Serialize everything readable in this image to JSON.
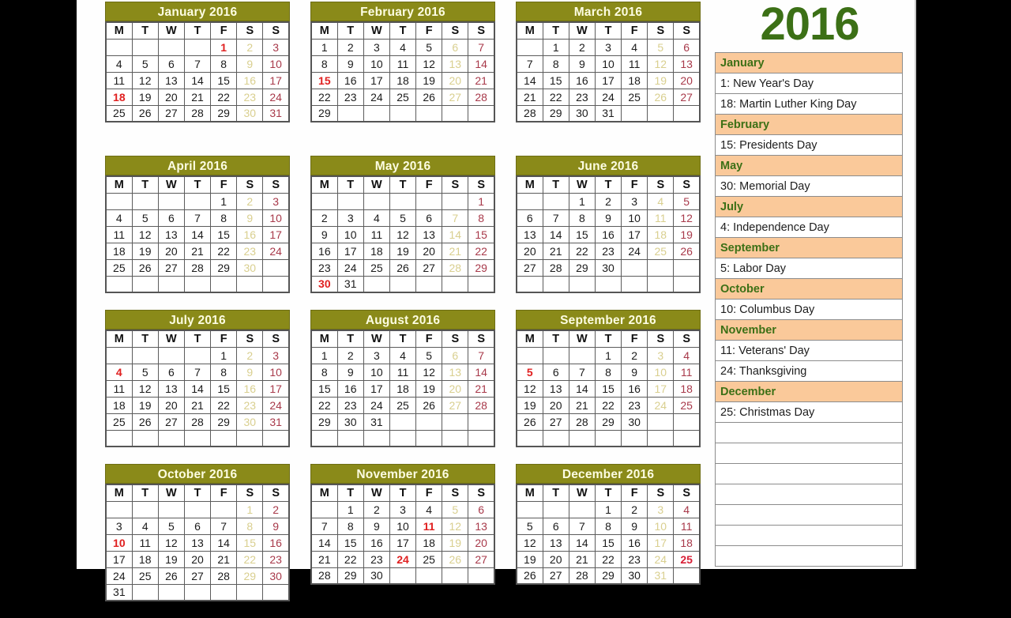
{
  "year_title": "2016",
  "weekday_headers": [
    "M",
    "T",
    "W",
    "T",
    "F",
    "S",
    "S"
  ],
  "colors": {
    "month_header_bg": "#8a8a19",
    "month_header_text": "#fdfde2",
    "saturday": "#d9cf8f",
    "sunday": "#a8394a",
    "holiday": "#e02020",
    "year_green": "#3c7016",
    "sidebar_month_bg": "#fac99a",
    "sidebar_month_text": "#3c7016",
    "page_bg": "#fefefe",
    "letterbox": "#000000"
  },
  "months": [
    {
      "title": "January 2016",
      "weeks": [
        [
          "",
          "",
          "",
          "",
          "1",
          "2",
          "3"
        ],
        [
          "4",
          "5",
          "6",
          "7",
          "8",
          "9",
          "10"
        ],
        [
          "11",
          "12",
          "13",
          "14",
          "15",
          "16",
          "17"
        ],
        [
          "18",
          "19",
          "20",
          "21",
          "22",
          "23",
          "24"
        ],
        [
          "25",
          "26",
          "27",
          "28",
          "29",
          "30",
          "31"
        ]
      ],
      "holidays": [
        "1",
        "18"
      ]
    },
    {
      "title": "February 2016",
      "weeks": [
        [
          "1",
          "2",
          "3",
          "4",
          "5",
          "6",
          "7"
        ],
        [
          "8",
          "9",
          "10",
          "11",
          "12",
          "13",
          "14"
        ],
        [
          "15",
          "16",
          "17",
          "18",
          "19",
          "20",
          "21"
        ],
        [
          "22",
          "23",
          "24",
          "25",
          "26",
          "27",
          "28"
        ],
        [
          "29",
          "",
          "",
          "",
          "",
          "",
          ""
        ]
      ],
      "holidays": [
        "15"
      ]
    },
    {
      "title": "March 2016",
      "weeks": [
        [
          "",
          "1",
          "2",
          "3",
          "4",
          "5",
          "6"
        ],
        [
          "7",
          "8",
          "9",
          "10",
          "11",
          "12",
          "13"
        ],
        [
          "14",
          "15",
          "16",
          "17",
          "18",
          "19",
          "20"
        ],
        [
          "21",
          "22",
          "23",
          "24",
          "25",
          "26",
          "27"
        ],
        [
          "28",
          "29",
          "30",
          "31",
          "",
          "",
          ""
        ]
      ],
      "holidays": []
    },
    {
      "title": "April 2016",
      "weeks": [
        [
          "",
          "",
          "",
          "",
          "1",
          "2",
          "3"
        ],
        [
          "4",
          "5",
          "6",
          "7",
          "8",
          "9",
          "10"
        ],
        [
          "11",
          "12",
          "13",
          "14",
          "15",
          "16",
          "17"
        ],
        [
          "18",
          "19",
          "20",
          "21",
          "22",
          "23",
          "24"
        ],
        [
          "25",
          "26",
          "27",
          "28",
          "29",
          "30",
          ""
        ],
        [
          "",
          "",
          "",
          "",
          "",
          "",
          ""
        ]
      ],
      "holidays": []
    },
    {
      "title": "May 2016",
      "weeks": [
        [
          "",
          "",
          "",
          "",
          "",
          "",
          "1"
        ],
        [
          "2",
          "3",
          "4",
          "5",
          "6",
          "7",
          "8"
        ],
        [
          "9",
          "10",
          "11",
          "12",
          "13",
          "14",
          "15"
        ],
        [
          "16",
          "17",
          "18",
          "19",
          "20",
          "21",
          "22"
        ],
        [
          "23",
          "24",
          "25",
          "26",
          "27",
          "28",
          "29"
        ],
        [
          "30",
          "31",
          "",
          "",
          "",
          "",
          ""
        ]
      ],
      "holidays": [
        "30"
      ]
    },
    {
      "title": "June 2016",
      "weeks": [
        [
          "",
          "",
          "1",
          "2",
          "3",
          "4",
          "5"
        ],
        [
          "6",
          "7",
          "8",
          "9",
          "10",
          "11",
          "12"
        ],
        [
          "13",
          "14",
          "15",
          "16",
          "17",
          "18",
          "19"
        ],
        [
          "20",
          "21",
          "22",
          "23",
          "24",
          "25",
          "26"
        ],
        [
          "27",
          "28",
          "29",
          "30",
          "",
          "",
          ""
        ],
        [
          "",
          "",
          "",
          "",
          "",
          "",
          ""
        ]
      ],
      "holidays": []
    },
    {
      "title": "July 2016",
      "weeks": [
        [
          "",
          "",
          "",
          "",
          "1",
          "2",
          "3"
        ],
        [
          "4",
          "5",
          "6",
          "7",
          "8",
          "9",
          "10"
        ],
        [
          "11",
          "12",
          "13",
          "14",
          "15",
          "16",
          "17"
        ],
        [
          "18",
          "19",
          "20",
          "21",
          "22",
          "23",
          "24"
        ],
        [
          "25",
          "26",
          "27",
          "28",
          "29",
          "30",
          "31"
        ],
        [
          "",
          "",
          "",
          "",
          "",
          "",
          ""
        ]
      ],
      "holidays": [
        "4"
      ]
    },
    {
      "title": "August 2016",
      "weeks": [
        [
          "1",
          "2",
          "3",
          "4",
          "5",
          "6",
          "7"
        ],
        [
          "8",
          "9",
          "10",
          "11",
          "12",
          "13",
          "14"
        ],
        [
          "15",
          "16",
          "17",
          "18",
          "19",
          "20",
          "21"
        ],
        [
          "22",
          "23",
          "24",
          "25",
          "26",
          "27",
          "28"
        ],
        [
          "29",
          "30",
          "31",
          "",
          "",
          "",
          ""
        ],
        [
          "",
          "",
          "",
          "",
          "",
          "",
          ""
        ]
      ],
      "holidays": []
    },
    {
      "title": "September 2016",
      "weeks": [
        [
          "",
          "",
          "",
          "1",
          "2",
          "3",
          "4"
        ],
        [
          "5",
          "6",
          "7",
          "8",
          "9",
          "10",
          "11"
        ],
        [
          "12",
          "13",
          "14",
          "15",
          "16",
          "17",
          "18"
        ],
        [
          "19",
          "20",
          "21",
          "22",
          "23",
          "24",
          "25"
        ],
        [
          "26",
          "27",
          "28",
          "29",
          "30",
          "",
          ""
        ],
        [
          "",
          "",
          "",
          "",
          "",
          "",
          ""
        ]
      ],
      "holidays": [
        "5"
      ]
    },
    {
      "title": "October 2016",
      "weeks": [
        [
          "",
          "",
          "",
          "",
          "",
          "1",
          "2"
        ],
        [
          "3",
          "4",
          "5",
          "6",
          "7",
          "8",
          "9"
        ],
        [
          "10",
          "11",
          "12",
          "13",
          "14",
          "15",
          "16"
        ],
        [
          "17",
          "18",
          "19",
          "20",
          "21",
          "22",
          "23"
        ],
        [
          "24",
          "25",
          "26",
          "27",
          "28",
          "29",
          "30"
        ],
        [
          "31",
          "",
          "",
          "",
          "",
          "",
          ""
        ]
      ],
      "holidays": [
        "10"
      ]
    },
    {
      "title": "November 2016",
      "weeks": [
        [
          "",
          "1",
          "2",
          "3",
          "4",
          "5",
          "6"
        ],
        [
          "7",
          "8",
          "9",
          "10",
          "11",
          "12",
          "13"
        ],
        [
          "14",
          "15",
          "16",
          "17",
          "18",
          "19",
          "20"
        ],
        [
          "21",
          "22",
          "23",
          "24",
          "25",
          "26",
          "27"
        ],
        [
          "28",
          "29",
          "30",
          "",
          "",
          "",
          ""
        ]
      ],
      "holidays": [
        "11",
        "24"
      ]
    },
    {
      "title": "December 2016",
      "weeks": [
        [
          "",
          "",
          "",
          "1",
          "2",
          "3",
          "4"
        ],
        [
          "5",
          "6",
          "7",
          "8",
          "9",
          "10",
          "11"
        ],
        [
          "12",
          "13",
          "14",
          "15",
          "16",
          "17",
          "18"
        ],
        [
          "19",
          "20",
          "21",
          "22",
          "23",
          "24",
          "25"
        ],
        [
          "26",
          "27",
          "28",
          "29",
          "30",
          "31",
          ""
        ]
      ],
      "holidays": [
        "25"
      ]
    }
  ],
  "holiday_panel": {
    "rows": [
      {
        "type": "month",
        "text": "January"
      },
      {
        "type": "item",
        "text": "1: New Year's Day"
      },
      {
        "type": "item",
        "text": "18: Martin Luther King Day"
      },
      {
        "type": "month",
        "text": "February"
      },
      {
        "type": "item",
        "text": "15: Presidents Day"
      },
      {
        "type": "month",
        "text": "May"
      },
      {
        "type": "item",
        "text": "30: Memorial Day"
      },
      {
        "type": "month",
        "text": "July"
      },
      {
        "type": "item",
        "text": "4: Independence Day"
      },
      {
        "type": "month",
        "text": "September"
      },
      {
        "type": "item",
        "text": "5: Labor Day"
      },
      {
        "type": "month",
        "text": "October"
      },
      {
        "type": "item",
        "text": "10: Columbus Day"
      },
      {
        "type": "month",
        "text": "November"
      },
      {
        "type": "item",
        "text": "11: Veterans' Day"
      },
      {
        "type": "item",
        "text": "24: Thanksgiving"
      },
      {
        "type": "month",
        "text": "December"
      },
      {
        "type": "item",
        "text": "25: Christmas Day"
      },
      {
        "type": "blank",
        "text": ""
      },
      {
        "type": "blank",
        "text": ""
      },
      {
        "type": "blank",
        "text": ""
      },
      {
        "type": "blank",
        "text": ""
      },
      {
        "type": "blank",
        "text": ""
      },
      {
        "type": "blank",
        "text": ""
      },
      {
        "type": "blank",
        "text": ""
      }
    ]
  }
}
